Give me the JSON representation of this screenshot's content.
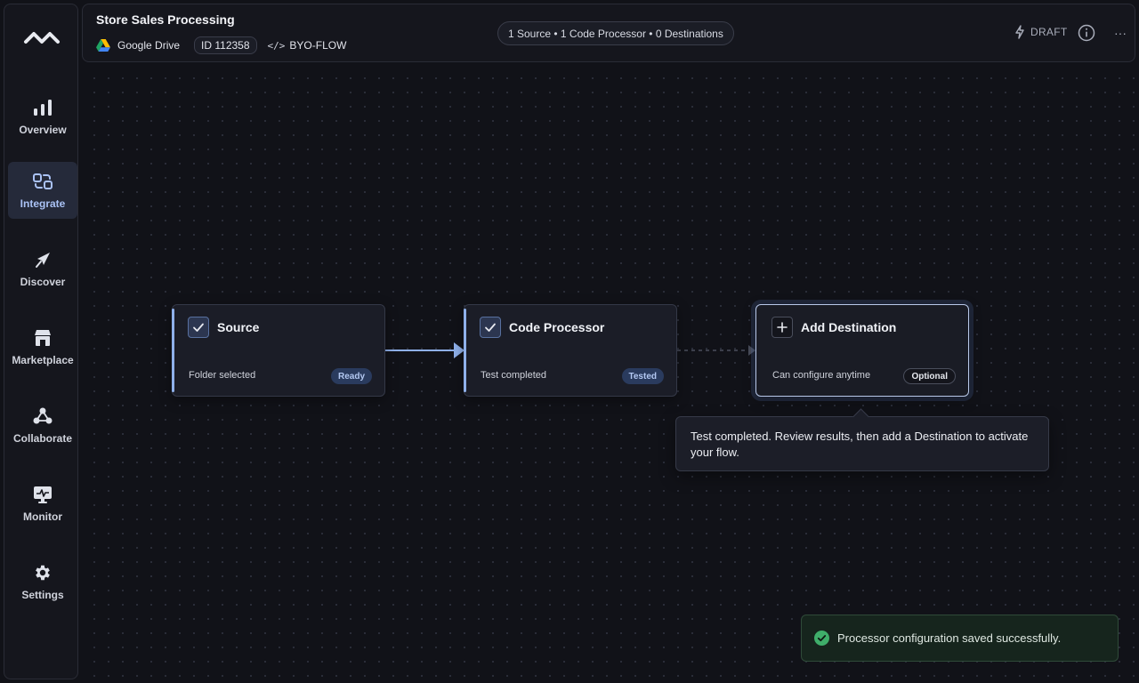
{
  "header": {
    "title": "Store Sales Processing",
    "source_name": "Google Drive",
    "flow_id": "ID 112358",
    "flow_type": "BYO-FLOW",
    "flow_type_icon": "code-icon",
    "summary": "1 Source • 1 Code Processor • 0 Destinations",
    "status": "DRAFT",
    "more": "···"
  },
  "sidebar": {
    "items": [
      {
        "label": "Overview",
        "icon": "bar-chart-icon"
      },
      {
        "label": "Integrate",
        "icon": "integrate-icon",
        "active": true
      },
      {
        "label": "Discover",
        "icon": "compass-icon"
      },
      {
        "label": "Marketplace",
        "icon": "store-icon"
      },
      {
        "label": "Collaborate",
        "icon": "network-icon"
      },
      {
        "label": "Monitor",
        "icon": "monitor-icon"
      },
      {
        "label": "Settings",
        "icon": "gear-icon"
      }
    ]
  },
  "flow": {
    "source": {
      "title": "Source",
      "status": "Folder selected",
      "badge": "Ready"
    },
    "processor": {
      "title": "Code Processor",
      "status": "Test completed",
      "badge": "Tested"
    },
    "destination": {
      "title": "Add Destination",
      "status": "Can configure anytime",
      "badge": "Optional"
    }
  },
  "tooltip": {
    "text": "Test completed. Review results, then add a Destination to activate your flow."
  },
  "toast": {
    "message": "Processor configuration saved successfully."
  },
  "colors": {
    "accent": "#8fb0ea",
    "background": "#111218",
    "success": "#3fae6a"
  }
}
